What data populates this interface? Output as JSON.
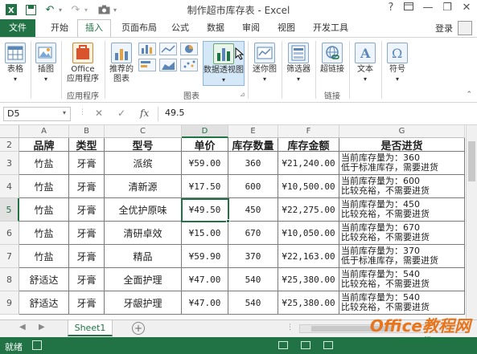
{
  "titlebar": {
    "title": "制作超市库存表 - Excel",
    "help": "?",
    "minimize": "—",
    "restore": "❐",
    "close": "✕"
  },
  "tabs": {
    "file": "文件",
    "items": [
      "开始",
      "插入",
      "页面布局",
      "公式",
      "数据",
      "审阅",
      "视图",
      "开发工具"
    ],
    "active": "插入",
    "login": "登录"
  },
  "ribbon": {
    "table": "表格",
    "illustrations": "插图",
    "office_apps_line1": "Office",
    "office_apps_line2": "应用程序",
    "recommended_charts_line1": "推荐的",
    "recommended_charts_line2": "图表",
    "pivot_chart": "数据透视图",
    "sparklines": "迷你图",
    "slicer": "筛选器",
    "hyperlink": "超链接",
    "text": "文本",
    "symbols": "符号",
    "group_apps": "应用程序",
    "group_charts": "图表",
    "group_links": "链接"
  },
  "formula_bar": {
    "name_box": "D5",
    "cancel": "✕",
    "enter": "✓",
    "fx": "fx",
    "value": "49.5"
  },
  "columns": [
    "A",
    "B",
    "C",
    "D",
    "E",
    "F",
    "G"
  ],
  "selected_column": "D",
  "rows": [
    {
      "num": "2",
      "cells": [
        "品牌",
        "类型",
        "型号",
        "单价",
        "库存数量",
        "库存金额",
        "是否进货"
      ],
      "header": true
    },
    {
      "num": "3",
      "cells": [
        "竹盐",
        "牙膏",
        "派缤",
        "¥59.00",
        "360",
        "¥21,240.00"
      ],
      "note": [
        "当前库存量为：360",
        "低于标准库存，需要进货"
      ]
    },
    {
      "num": "4",
      "cells": [
        "竹盐",
        "牙膏",
        "清新源",
        "¥17.50",
        "600",
        "¥10,500.00"
      ],
      "note": [
        "当前库存量为：600",
        "比较充裕，不需要进货"
      ]
    },
    {
      "num": "5",
      "cells": [
        "竹盐",
        "牙膏",
        "全优护原味",
        "¥49.50",
        "450",
        "¥22,275.00"
      ],
      "note": [
        "当前库存量为：450",
        "比较充裕，不需要进货"
      ]
    },
    {
      "num": "6",
      "cells": [
        "竹盐",
        "牙膏",
        "清研卓效",
        "¥15.00",
        "670",
        "¥10,050.00"
      ],
      "note": [
        "当前库存量为：670",
        "比较充裕，不需要进货"
      ]
    },
    {
      "num": "7",
      "cells": [
        "竹盐",
        "牙膏",
        "精品",
        "¥59.90",
        "370",
        "¥22,163.00"
      ],
      "note": [
        "当前库存量为：370",
        "低于标准库存，需要进货"
      ]
    },
    {
      "num": "8",
      "cells": [
        "舒适达",
        "牙膏",
        "全面护理",
        "¥47.00",
        "540",
        "¥25,380.00"
      ],
      "note": [
        "当前库存量为：540",
        "比较充裕，不需要进货"
      ]
    },
    {
      "num": "9",
      "cells": [
        "舒适达",
        "牙膏",
        "牙龈护理",
        "¥47.00",
        "540",
        "¥25,380.00"
      ],
      "note": [
        "当前库存量为：540",
        "比较充裕，不需要进货"
      ]
    }
  ],
  "selected_row": "5",
  "sheets": {
    "active": "Sheet1",
    "add": "+"
  },
  "status": {
    "text": "就绪"
  },
  "watermark": {
    "logo": "Office教程网",
    "url": "www.office26.com"
  },
  "colors": {
    "excel_green": "#217346",
    "watermark_orange": "#e8741c"
  }
}
